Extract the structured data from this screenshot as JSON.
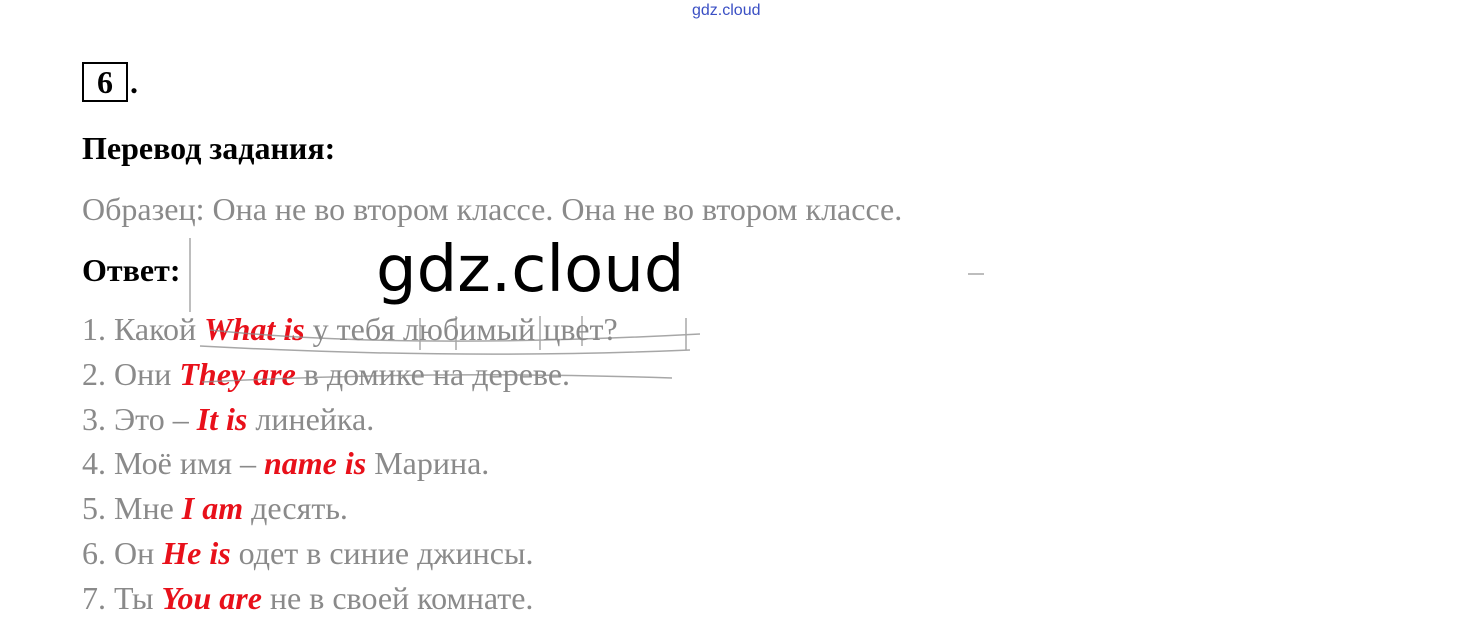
{
  "watermark_top": "gdz.cloud",
  "watermark_big": "gdz.cloud",
  "task": {
    "number": "6",
    "dot": "."
  },
  "heading": "Перевод задания:",
  "example": "Образец: Она не во втором классе. Она не во втором классе.",
  "answer_label": "Ответ:",
  "answers": [
    {
      "num": "1.",
      "before": "Какой",
      "answer": "What is",
      "after": "у тебя любимый цвет?"
    },
    {
      "num": "2.",
      "before": "Они",
      "answer": "They are",
      "after": "в домике на дереве."
    },
    {
      "num": "3.",
      "before": "Это –",
      "answer": "It is",
      "after": "линейка."
    },
    {
      "num": "4.",
      "before": "Моё имя –",
      "answer": "name is",
      "after": "Марина."
    },
    {
      "num": "5.",
      "before": "Мне",
      "answer": "I am",
      "after": "десять."
    },
    {
      "num": "6.",
      "before": "Он",
      "answer": "He is",
      "after": "одет в синие джинсы."
    },
    {
      "num": "7.",
      "before": "Ты",
      "answer": "You are",
      "after": "не в своей комнате."
    }
  ],
  "colors": {
    "answer": "#e8101a",
    "body_text": "#8a8a8a",
    "watermark_top": "#3a4fc4"
  }
}
